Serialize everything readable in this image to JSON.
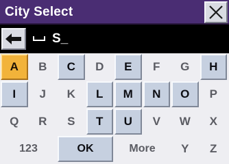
{
  "title": "City Select",
  "input": {
    "typed": "S_"
  },
  "icons": {
    "close": "close-icon",
    "back": "backspace-arrow-icon",
    "space": "space-icon"
  },
  "colors": {
    "titlebar": "#4a2d73",
    "active_key": "#f2b33a",
    "raised_key": "#c6d0e0"
  },
  "rows": [
    [
      {
        "label": "A",
        "state": "active"
      },
      {
        "label": "B",
        "state": "flat"
      },
      {
        "label": "C",
        "state": "raised"
      },
      {
        "label": "D",
        "state": "flat"
      },
      {
        "label": "E",
        "state": "raised"
      },
      {
        "label": "F",
        "state": "flat"
      },
      {
        "label": "G",
        "state": "flat"
      },
      {
        "label": "H",
        "state": "raised"
      }
    ],
    [
      {
        "label": "I",
        "state": "raised"
      },
      {
        "label": "J",
        "state": "flat"
      },
      {
        "label": "K",
        "state": "flat"
      },
      {
        "label": "L",
        "state": "raised"
      },
      {
        "label": "M",
        "state": "raised"
      },
      {
        "label": "N",
        "state": "raised"
      },
      {
        "label": "O",
        "state": "raised"
      },
      {
        "label": "P",
        "state": "flat"
      }
    ],
    [
      {
        "label": "Q",
        "state": "flat"
      },
      {
        "label": "R",
        "state": "flat"
      },
      {
        "label": "S",
        "state": "flat"
      },
      {
        "label": "T",
        "state": "raised"
      },
      {
        "label": "U",
        "state": "raised"
      },
      {
        "label": "V",
        "state": "flat"
      },
      {
        "label": "W",
        "state": "flat"
      },
      {
        "label": "X",
        "state": "flat"
      }
    ],
    [
      {
        "label": "123",
        "state": "flat",
        "span": 2
      },
      {
        "label": "OK",
        "state": "raised",
        "span": 2
      },
      {
        "label": "More",
        "state": "flat",
        "span": 2
      },
      {
        "label": "Y",
        "state": "flat"
      },
      {
        "label": "Z",
        "state": "flat"
      }
    ]
  ]
}
